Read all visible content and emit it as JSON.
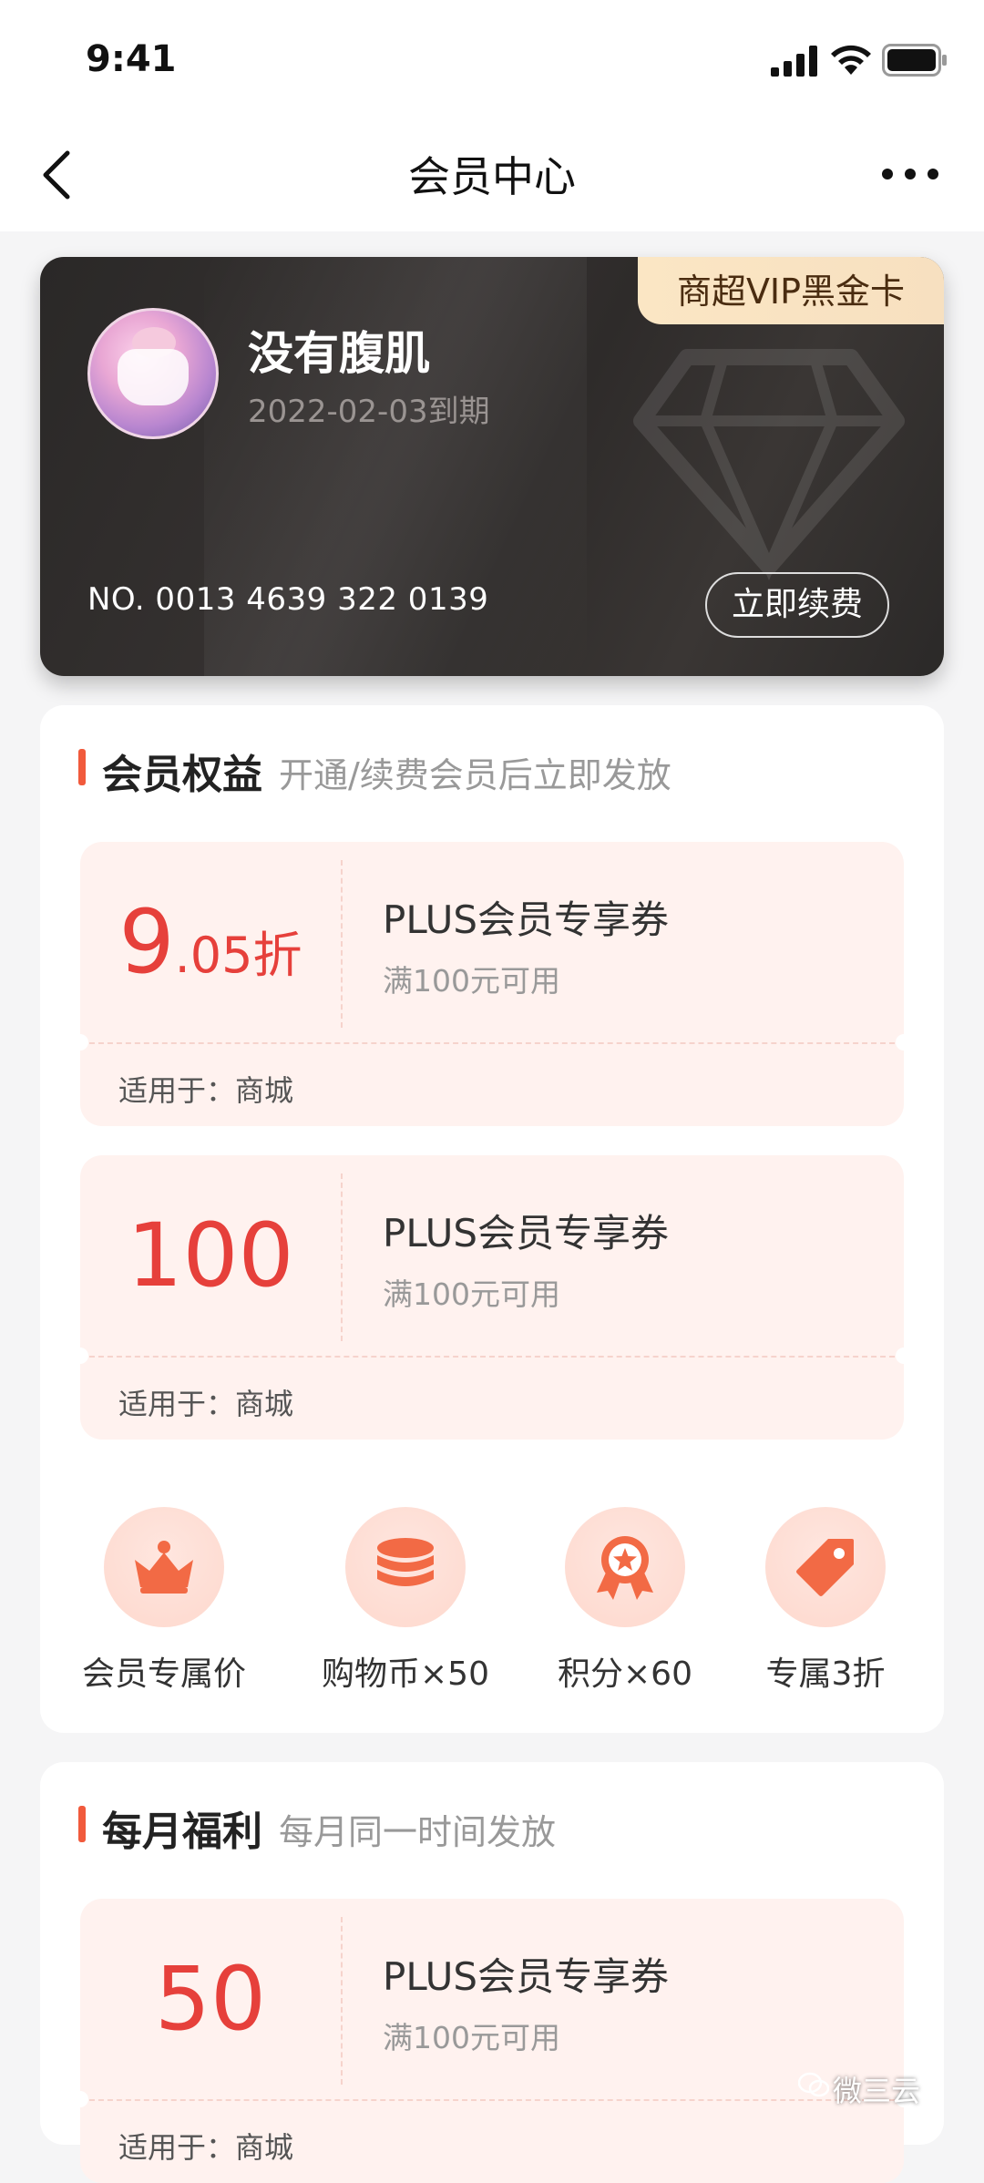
{
  "status_bar": {
    "time": "9:41"
  },
  "nav": {
    "title": "会员中心"
  },
  "card": {
    "badge": "商超VIP黑金卡",
    "username": "没有腹肌",
    "expire": "2022-02-03到期",
    "card_no": "NO. 0013 4639 322 0139",
    "renew_label": "立即续费"
  },
  "benefits": {
    "title": "会员权益",
    "subtitle": "开通/续费会员后立即发放",
    "coupons": [
      {
        "value_main": "9",
        "value_small": ".05折",
        "name": "PLUS会员专享券",
        "condition": "满100元可用",
        "scope": "适用于：商城"
      },
      {
        "value_main": "100",
        "value_small": "",
        "name": "PLUS会员专享券",
        "condition": "满100元可用",
        "scope": "适用于：商城"
      }
    ],
    "perks": [
      {
        "icon": "crown-icon",
        "label": "会员专属价"
      },
      {
        "icon": "coins-icon",
        "label": "购物币×50"
      },
      {
        "icon": "medal-icon",
        "label": "积分×60"
      },
      {
        "icon": "tag-icon",
        "label": "专属3折"
      }
    ]
  },
  "monthly": {
    "title": "每月福利",
    "subtitle": "每月同一时间发放",
    "coupons": [
      {
        "value_main": "50",
        "value_small": "",
        "name": "PLUS会员专享券",
        "condition": "满100元可用",
        "scope": "适用于：商城"
      }
    ]
  },
  "watermark": "微三云",
  "colors": {
    "accent": "#e6403b",
    "coupon_bg": "#fff2ef",
    "card_bg": "#2e2b2a",
    "badge_bg": "#fbe6c4"
  }
}
